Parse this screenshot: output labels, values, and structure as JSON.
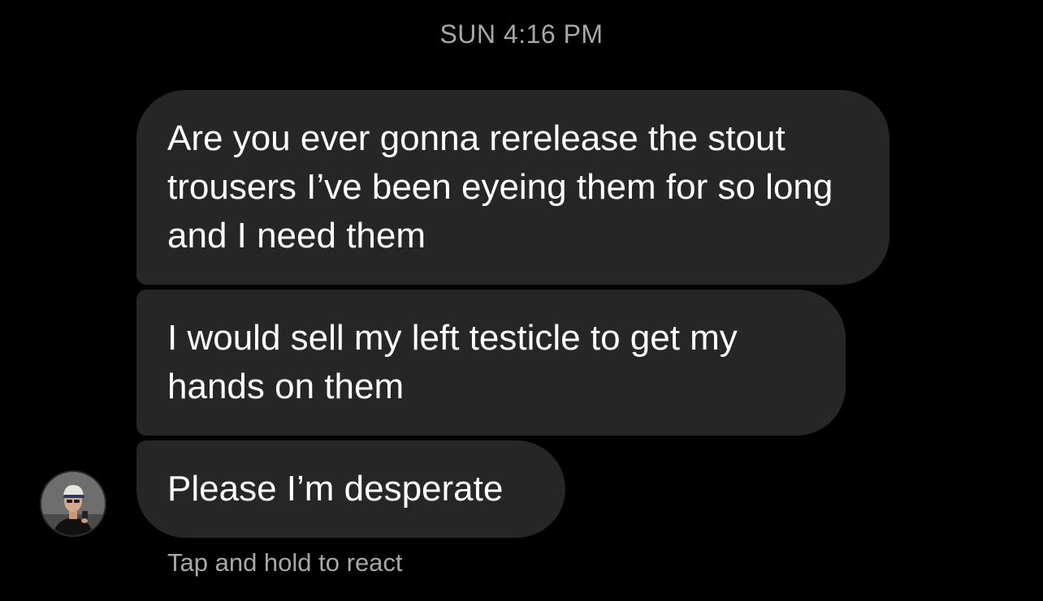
{
  "thread": {
    "timestamp": "SUN 4:16 PM",
    "messages": [
      {
        "text": "Are you ever gonna rerelease the stout trousers I’ve been eyeing them for so long and I need them"
      },
      {
        "text": "I would sell my left testicle to get my hands on them"
      },
      {
        "text": "Please I’m desperate"
      }
    ],
    "avatar_icon": "user-avatar-photo",
    "react_hint": "Tap and hold to react"
  },
  "colors": {
    "background": "#000000",
    "bubble": "#262626",
    "text": "#ffffff",
    "secondary_text": "#a7a7a7"
  }
}
